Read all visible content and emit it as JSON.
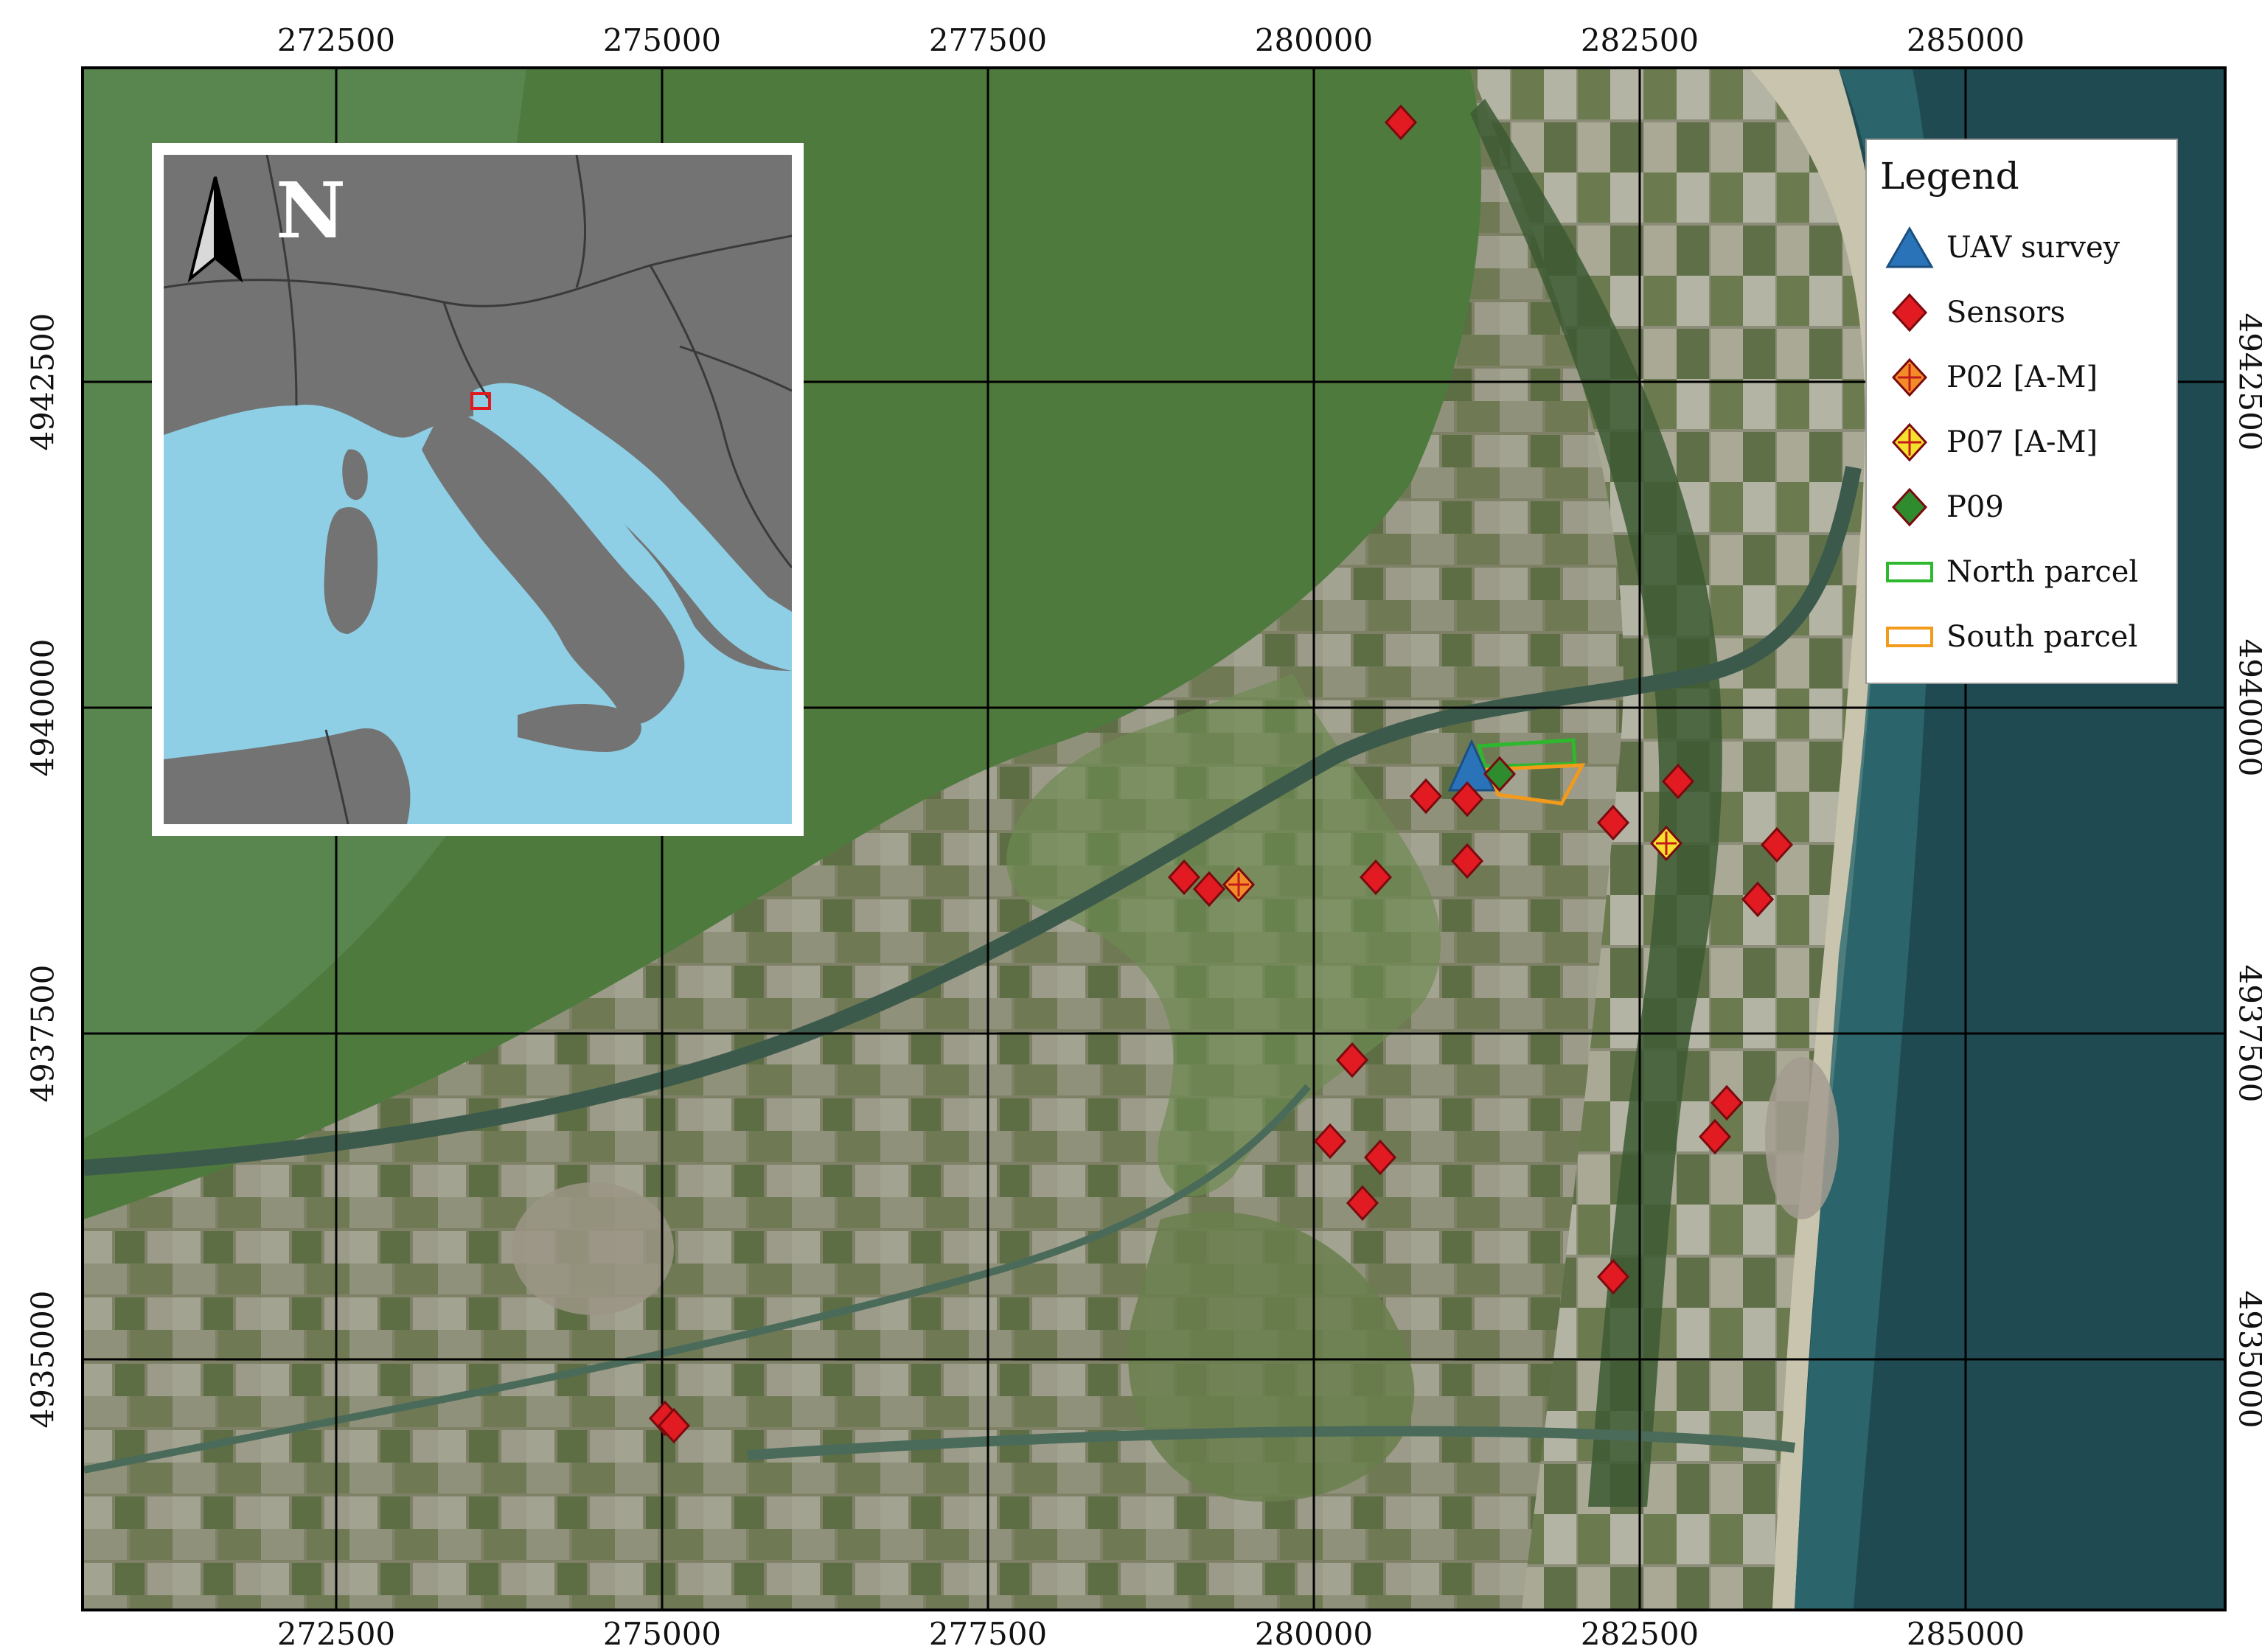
{
  "axes": {
    "x_ticks": [
      "272500",
      "275000",
      "277500",
      "280000",
      "282500",
      "285000"
    ],
    "y_ticks": [
      "4942500",
      "4940000",
      "4937500",
      "4935000"
    ]
  },
  "inset": {
    "north_label": "N",
    "colors": {
      "sea": "#8ecfe6",
      "land": "#737373",
      "border": "#3a3a3a",
      "study_area": "#e0191f"
    }
  },
  "legend": {
    "title": "Legend",
    "items": [
      {
        "label": "UAV survey",
        "symbol": "uav-triangle-icon",
        "color": "#2b73b8"
      },
      {
        "label": "Sensors",
        "symbol": "sensor-diamond-icon",
        "color": "#e21b23"
      },
      {
        "label": "P02 [A-M]",
        "symbol": "p02-diamond-icon",
        "color": "#f28c28"
      },
      {
        "label": "P07 [A-M]",
        "symbol": "p07-diamond-icon",
        "color": "#f5e02e"
      },
      {
        "label": "P09",
        "symbol": "p09-diamond-icon",
        "color": "#2e8b2e"
      },
      {
        "label": "North parcel",
        "symbol": "north-parcel-box-icon",
        "color": "#2db82d"
      },
      {
        "label": "South parcel",
        "symbol": "south-parcel-box-icon",
        "color": "#f29a1a"
      }
    ]
  },
  "map_colors": {
    "lagoon": "#4f7a3e",
    "sea": "#1f4a52",
    "farmland": "#7d7f66",
    "grid": "#000000",
    "sensor": "#e21b23"
  }
}
